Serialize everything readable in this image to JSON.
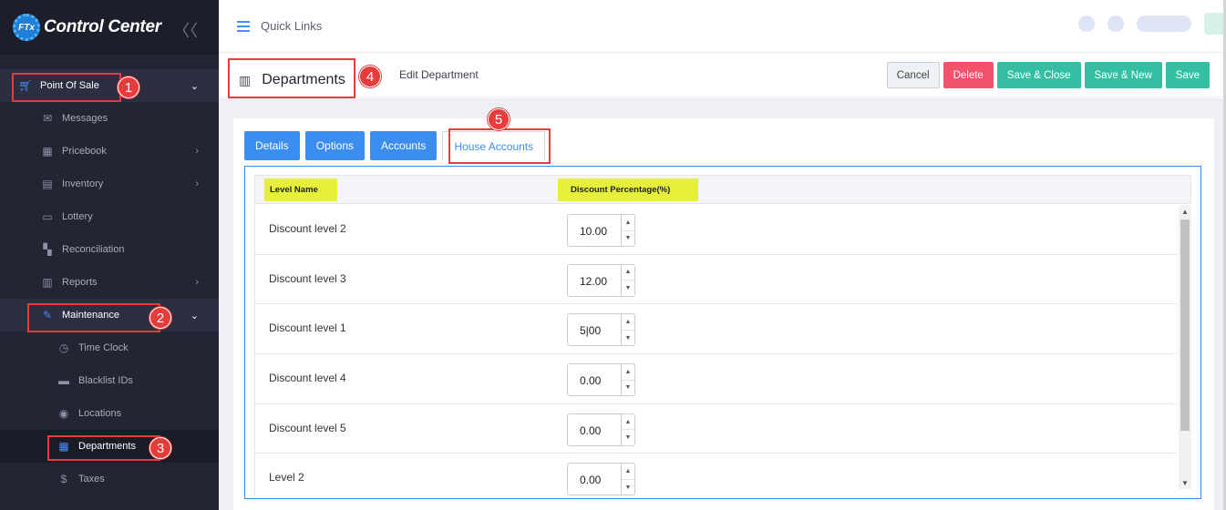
{
  "brand": {
    "logo_text": "FTx",
    "name": "Control Center"
  },
  "sidebar": {
    "collapse_glyph": "〈〈",
    "items": [
      {
        "label": "Point Of Sale",
        "icon": "cart-icon"
      },
      {
        "label": "Messages",
        "icon": "message-icon"
      },
      {
        "label": "Pricebook",
        "icon": "calculator-icon"
      },
      {
        "label": "Inventory",
        "icon": "inventory-icon"
      },
      {
        "label": "Lottery",
        "icon": "ticket-icon"
      },
      {
        "label": "Reconciliation",
        "icon": "grid-icon"
      },
      {
        "label": "Reports",
        "icon": "chart-icon"
      },
      {
        "label": "Maintenance",
        "icon": "wrench-icon"
      },
      {
        "label": "Time Clock",
        "icon": "clock-icon"
      },
      {
        "label": "Blacklist IDs",
        "icon": "card-icon"
      },
      {
        "label": "Locations",
        "icon": "pin-icon"
      },
      {
        "label": "Departments",
        "icon": "building-icon"
      },
      {
        "label": "Taxes",
        "icon": "dollar-icon"
      }
    ]
  },
  "topbar": {
    "quick_links": "Quick Links"
  },
  "subheader": {
    "title": "Departments",
    "breadcrumb": "Edit Department",
    "buttons": {
      "cancel": "Cancel",
      "delete": "Delete",
      "save_close": "Save & Close",
      "save_new": "Save & New",
      "save": "Save"
    }
  },
  "tabs": [
    "Details",
    "Options",
    "Accounts",
    "House Accounts"
  ],
  "grid": {
    "columns": [
      "Level Name",
      "Discount Percentage(%)"
    ],
    "rows": [
      {
        "name": "Discount level 2",
        "value": "10.00"
      },
      {
        "name": "Discount level 3",
        "value": "12.00"
      },
      {
        "name": "Discount level 1",
        "value": "5|00"
      },
      {
        "name": "Discount level 4",
        "value": "0.00"
      },
      {
        "name": "Discount level 5",
        "value": "0.00"
      },
      {
        "name": "Level 2",
        "value": "0.00"
      }
    ]
  },
  "annotations": [
    "1",
    "2",
    "3",
    "4",
    "5"
  ],
  "colors": {
    "accent": "#3b8ef0",
    "danger": "#f4516c",
    "success": "#34bfa3",
    "callout": "#e63c3c",
    "highlight": "#e6f03a"
  }
}
